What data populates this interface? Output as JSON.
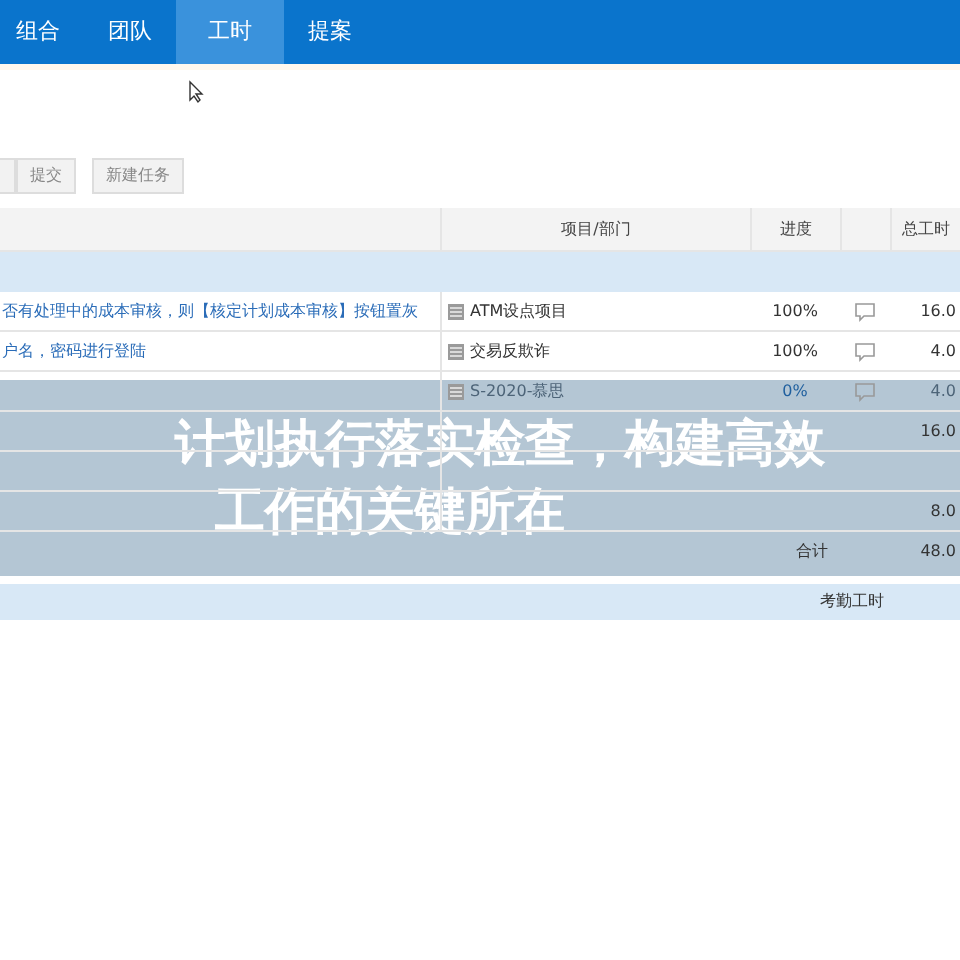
{
  "nav": {
    "tabs": [
      {
        "label": "组合",
        "selected": false
      },
      {
        "label": "团队",
        "selected": false
      },
      {
        "label": "工时",
        "selected": true
      },
      {
        "label": "提案",
        "selected": false
      }
    ]
  },
  "toolbar": {
    "buttons": [
      "提交",
      "新建任务"
    ]
  },
  "table": {
    "columns": [
      "项目/部门",
      "进度",
      "总工时"
    ],
    "rows": [
      {
        "task": "否有处理中的成本审核，则【核定计划成本审核】按钮置灰",
        "project": "ATM设点项目",
        "progress": "100%",
        "total": "16.0",
        "muted": false
      },
      {
        "task": "户名，密码进行登陆",
        "project": "交易反欺诈",
        "progress": "100%",
        "total": "4.0",
        "muted": false
      },
      {
        "task": "",
        "project": "S-2020-慕思",
        "progress": "0%",
        "total": "4.0",
        "muted": true
      },
      {
        "task": "",
        "project": "",
        "progress": "",
        "total": "16.0"
      },
      {
        "task": "",
        "project": "",
        "progress": "",
        "total": ""
      },
      {
        "task": "",
        "project": "",
        "progress": "",
        "total": "8.0"
      }
    ],
    "sum_label": "合计",
    "sum_value": "48.0",
    "footer": "考勤工时"
  },
  "banner": {
    "lines": [
      "计划执行落实检查，构建高效",
      "工作的关键所在"
    ]
  }
}
